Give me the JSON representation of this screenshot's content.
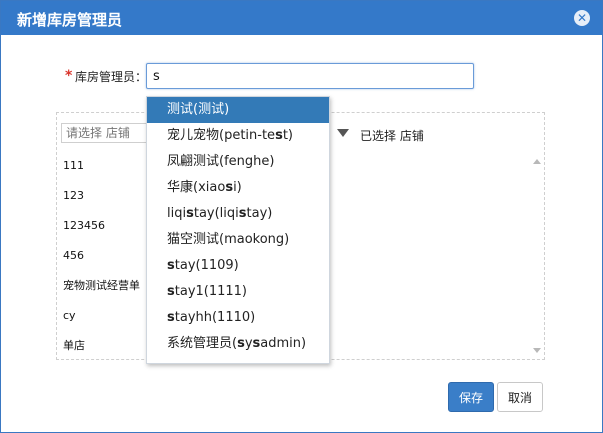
{
  "dialog": {
    "title": "新增库房管理员",
    "close_icon": "close-icon"
  },
  "form": {
    "required_mark": "*",
    "label": "库房管理员：",
    "input_value": "s"
  },
  "transfer": {
    "left_search_placeholder": "请选择 店铺",
    "right_heading": "已选择 店铺",
    "stores": [
      "111",
      "123",
      "123456",
      "456",
      "宠物测试经营单",
      "cy",
      "单店"
    ]
  },
  "dropdown": {
    "query": "s",
    "active_index": 0,
    "items": [
      "测试(测试)",
      "宠儿宠物(petin-test)",
      "凤翩测试(fenghe)",
      "华康(xiaosi)",
      "liqistay(liqistay)",
      "猫空测试(maokong)",
      "stay(1109)",
      "stay1(1111)",
      "stayhh(1110)",
      "系统管理员(sysadmin)"
    ]
  },
  "buttons": {
    "save": "保存",
    "cancel": "取消"
  },
  "colors": {
    "title_bar": "#3479c9",
    "active_item": "#337ab7",
    "required": "#d9342b",
    "save_button": "#3a7ec8"
  }
}
